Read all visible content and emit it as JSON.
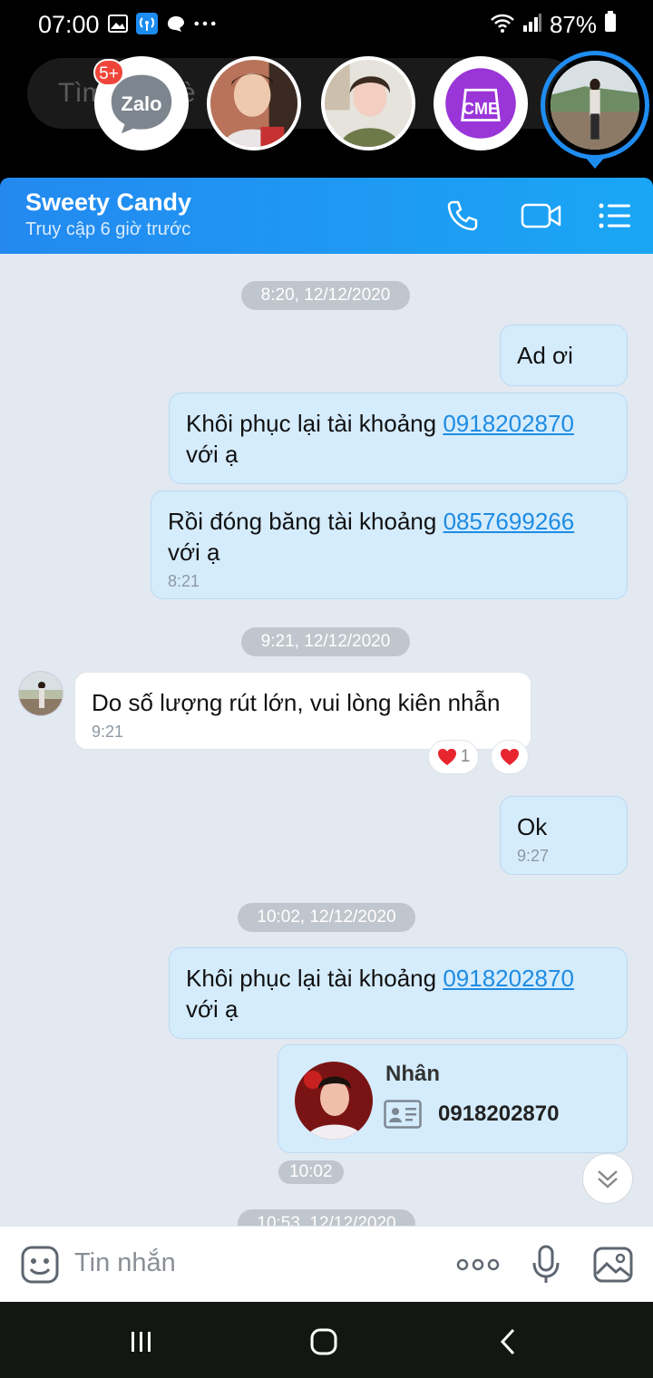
{
  "status_bar": {
    "time": "07:00",
    "battery": "87%",
    "left_icons": [
      "image-icon",
      "hotspot-icon",
      "chat-bubble-icon",
      "more-dots-icon"
    ],
    "right_icons": [
      "wifi-icon",
      "signal-icon",
      "battery-icon"
    ]
  },
  "chat_heads": {
    "search_ghost": "Tìm bạn bè",
    "zalo_label": "Zalo",
    "zalo_badge": "5+",
    "cme_label": "CME"
  },
  "header": {
    "contact_name": "Sweety Candy",
    "status": "Truy cập 6 giờ trước"
  },
  "messages": {
    "d1": "8:20, 12/12/2020",
    "m1": "Ad ơi",
    "m2_text": "Khôi phục lại tài khoảng",
    "m2_link": "0918202870",
    "m2_tail": "với ạ",
    "m3_text": "Rồi đóng băng tài khoảng",
    "m3_link": "0857699266",
    "m3_tail": "với ạ",
    "m3_time": "8:21",
    "d2": "9:21, 12/12/2020",
    "m4": "Do số lượng rút lớn, vui lòng kiên nhẫn",
    "m4_time": "9:21",
    "m4_reaction_count": "1",
    "m5": "Ok",
    "m5_time": "9:27",
    "d3": "10:02, 12/12/2020",
    "m6_text": "Khôi phục lại tài khoảng",
    "m6_link": "0918202870",
    "m6_tail": "với ạ",
    "card_name": "Nhân",
    "card_phone": "0918202870",
    "card_time": "10:02",
    "d4": "10:53, 12/12/2020"
  },
  "input": {
    "placeholder": "Tin nhắn"
  },
  "colors": {
    "header_gradient_start": "#2389f0",
    "header_gradient_end": "#1aa6f5",
    "outgoing_bubble": "#d5ecfd",
    "chat_bg": "#e2e9f1",
    "link": "#1e8ce3",
    "badge": "#f0453a"
  }
}
